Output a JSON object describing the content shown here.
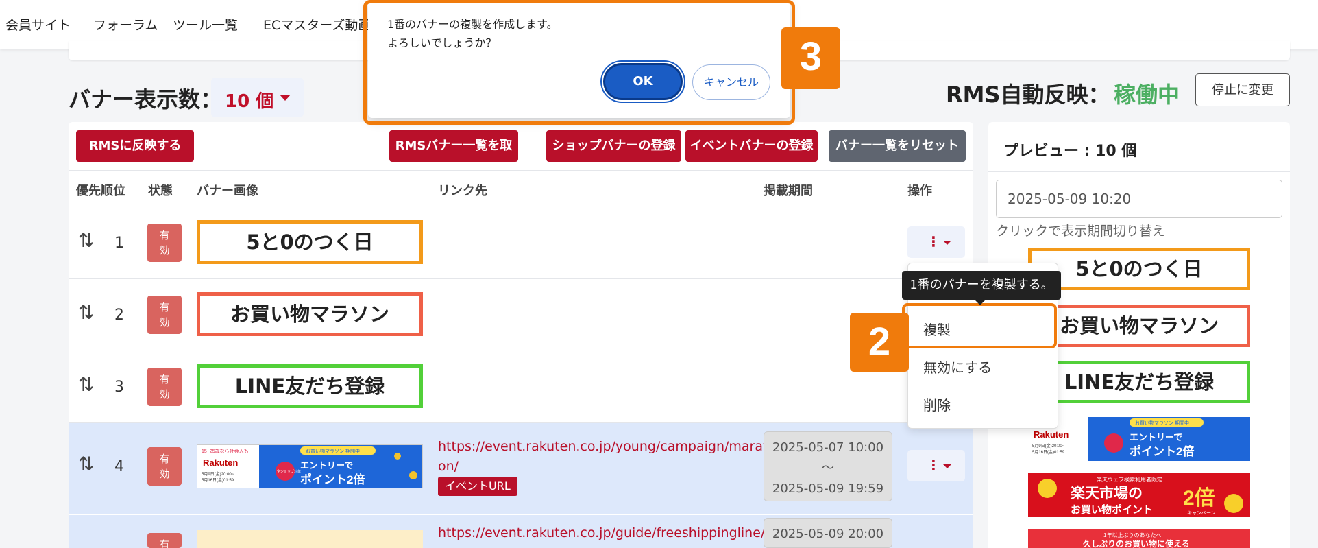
{
  "nav": {
    "items": [
      "会員サイト",
      "フォーラム",
      "ツール一覧",
      "ECマスターズ動画"
    ]
  },
  "banner_count": {
    "label": "バナー表示数：",
    "value": "10 個"
  },
  "rms": {
    "label": "RMS自動反映：",
    "status": "稼働中",
    "stop_button": "停止に変更"
  },
  "toolbar": {
    "reflect": "RMSに反映する",
    "fetch": "RMSバナー一覧を取得",
    "shop_register": "ショップバナーの登録",
    "event_register": "イベントバナーの登録",
    "reset": "バナー一覧をリセット"
  },
  "table": {
    "headers": {
      "priority": "優先順位",
      "status": "状態",
      "image": "バナー画像",
      "link": "リンク先",
      "period": "掲載期間",
      "ops": "操作"
    },
    "rows": [
      {
        "rank": "1",
        "status": "有\n効",
        "banner_text": "5と0のつく日",
        "border": "#f39a1a"
      },
      {
        "rank": "2",
        "status": "有\n効",
        "banner_text": "お買い物マラソン",
        "border": "#ef6048"
      },
      {
        "rank": "3",
        "status": "有\n効",
        "banner_text": "LINE友だち登録",
        "border": "#52d039"
      },
      {
        "rank": "4",
        "status": "有\n効",
        "link_line1": "https://event.rakuten.co.jp/young/campaign/marath",
        "link_line2": "on/",
        "link_badge": "イベントURL",
        "period_start": "2025-05-07 10:00",
        "period_sep": "〜",
        "period_end": "2025-05-09 19:59"
      },
      {
        "rank": "5",
        "status": "有",
        "link_line1": "https://event.rakuten.co.jp/guide/freeshippingline/ca",
        "period_start": "2025-05-09 20:00"
      }
    ]
  },
  "marathon_banner": {
    "left_top": "15~25歳なら社会人も!",
    "brand": "Rakuten",
    "left_date1": "5月9日(金)20:00~",
    "left_date2": "5月16日(金)01:59",
    "top_tag": "お買い物マラソン 期間中",
    "main1": "エントリーで",
    "main2": "ポイント2倍",
    "circle": "全ショップ対象"
  },
  "market_banner": {
    "top": "楽天ウェブ検索利用者限定",
    "main1": "楽天市場の",
    "main2": "お買い物ポイント",
    "big": "2倍",
    "sub": "キャンペーン"
  },
  "return_banner": {
    "line1": "1年以上ぶりのあなたへ",
    "line2": "久しぶりのお買い物に使える"
  },
  "dropdown": {
    "items": [
      "複製",
      "無効にする",
      "削除"
    ],
    "tooltip": "1番のバナーを複製する。"
  },
  "steps": {
    "two": "2",
    "three": "3"
  },
  "preview": {
    "title": "プレビュー : 10 個",
    "datetime": "2025-05-09 10:20",
    "hint": "クリックで表示期間切り替え"
  },
  "dialog": {
    "line1": "1番のバナーの複製を作成します。",
    "line2": "よろしいでしょうか？",
    "ok": "OK",
    "cancel": "キャンセル"
  },
  "colors": {
    "accent_red": "#b9102a",
    "status_green": "#4caf62",
    "highlight_orange": "#f07b0c",
    "ok_blue": "#1a5cc4"
  }
}
